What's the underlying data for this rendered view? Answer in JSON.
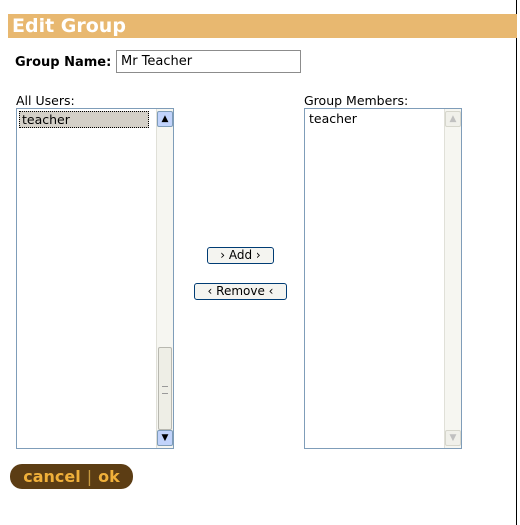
{
  "title": "Edit Group",
  "group_name": {
    "label": "Group Name:",
    "value": "Mr Teacher"
  },
  "all_users": {
    "label": "All Users:",
    "items": [
      "teacher"
    ]
  },
  "group_members": {
    "label": "Group Members:",
    "items": [
      "teacher"
    ]
  },
  "buttons": {
    "add": "› Add ›",
    "remove": "‹ Remove ‹"
  },
  "actions": {
    "cancel": "cancel",
    "separator": "|",
    "ok": "ok"
  }
}
